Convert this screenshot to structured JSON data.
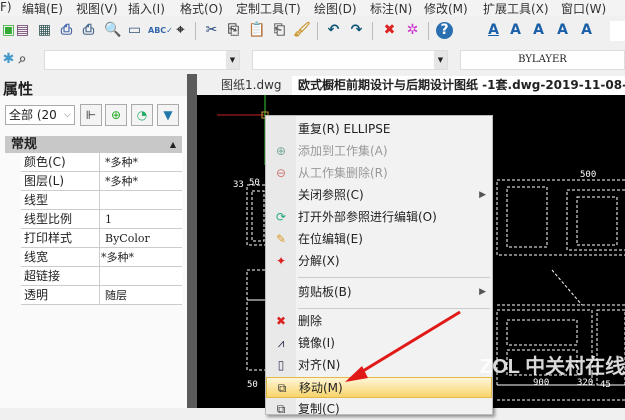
{
  "menubar": [
    "F)",
    "编辑(E)",
    "视图(V)",
    "插入(I)",
    "格式(O)",
    "定制工具(T)",
    "绘图(D)",
    "标注(N)",
    "修改(M)",
    "扩展工具(X)",
    "窗口(W)"
  ],
  "toolbar2": {
    "linetype_value": "BYLAYER"
  },
  "panel": {
    "title": "属性",
    "filter": "全部 (20",
    "group": "常规",
    "rows": [
      {
        "k": "颜色(C)",
        "v": "*多种*"
      },
      {
        "k": "图层(L)",
        "v": "*多种*"
      },
      {
        "k": "线型",
        "v": ""
      },
      {
        "k": "线型比例",
        "v": "1"
      },
      {
        "k": "打印样式",
        "v": "ByColor"
      },
      {
        "k": "线宽",
        "v": "*多种*"
      },
      {
        "k": "超链接",
        "v": ""
      },
      {
        "k": "透明",
        "v": "随层"
      }
    ]
  },
  "tabs": [
    "图纸1.dwg",
    "欧式橱柜前期设计与后期设计图纸 -1套.dwg-2019-11-08-"
  ],
  "context_menu": [
    {
      "label": "重复(R) ELLIPSE",
      "icon": "",
      "disabled": false
    },
    {
      "label": "添加到工作集(A)",
      "icon": "add-workset-icon",
      "disabled": true
    },
    {
      "label": "从工作集删除(R)",
      "icon": "remove-workset-icon",
      "disabled": true
    },
    {
      "label": "关闭参照(C)",
      "icon": "",
      "disabled": false,
      "submenu": true
    },
    {
      "label": "打开外部参照进行编辑(O)",
      "icon": "open-xref-icon",
      "disabled": false
    },
    {
      "label": "在位编辑(E)",
      "icon": "edit-in-place-icon",
      "disabled": false
    },
    {
      "label": "分解(X)",
      "icon": "explode-icon",
      "disabled": false
    },
    {
      "label": "剪贴板(B)",
      "icon": "",
      "disabled": false,
      "submenu": true
    },
    {
      "label": "删除",
      "icon": "delete-icon",
      "disabled": false
    },
    {
      "label": "镜像(I)",
      "icon": "mirror-icon",
      "disabled": false
    },
    {
      "label": "对齐(N)",
      "icon": "align-icon",
      "disabled": false
    },
    {
      "label": "移动(M)",
      "icon": "move-icon",
      "disabled": false,
      "highlighted": true
    },
    {
      "label": "复制(C)",
      "icon": "copy-icon",
      "disabled": false
    }
  ],
  "drawing": {
    "dims": [
      "50",
      "500",
      "33",
      "900",
      "320",
      "45",
      "50"
    ]
  },
  "watermark": "ZOL 中关村在线"
}
